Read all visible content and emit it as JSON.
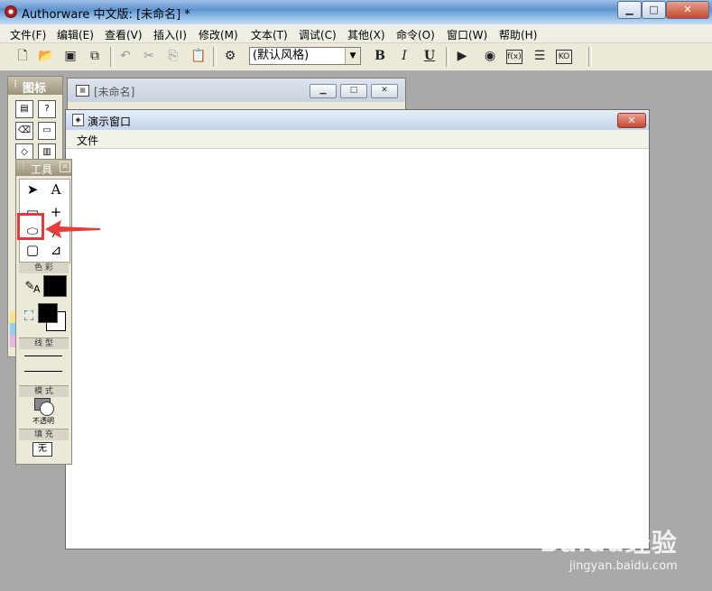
{
  "window": {
    "title": "Authorware 中文版: [未命名] *",
    "buttons": {
      "minimize": "▁",
      "maximize": "□",
      "close": "✕"
    }
  },
  "menubar": [
    "文件(F)",
    "编辑(E)",
    "查看(V)",
    "插入(I)",
    "修改(M)",
    "文本(T)",
    "调试(C)",
    "其他(X)",
    "命令(O)",
    "窗口(W)",
    "帮助(H)"
  ],
  "toolbar": {
    "style_select_value": "(默认风格)",
    "bold": "B",
    "italic": "I",
    "underline": "U"
  },
  "icon_palette": {
    "title": "图标"
  },
  "design_window": {
    "title": "[未命名]"
  },
  "presentation_window": {
    "title": "演示窗口",
    "menu": [
      "文件"
    ]
  },
  "tool_palette": {
    "title": "工具",
    "text_tool": "A",
    "sections": {
      "color": "色 彩",
      "line": "线 型",
      "mode": "模 式",
      "fill": "填 充"
    },
    "mode_value": "不透明",
    "fill_value": "无",
    "pen_label": "A"
  },
  "watermark": {
    "logo": "Baidu经验",
    "url": "jingyan.baidu.com"
  },
  "colors": {
    "highlight": "#e23b3b",
    "foreground_color": "#000000",
    "background_color": "#ffffff"
  }
}
